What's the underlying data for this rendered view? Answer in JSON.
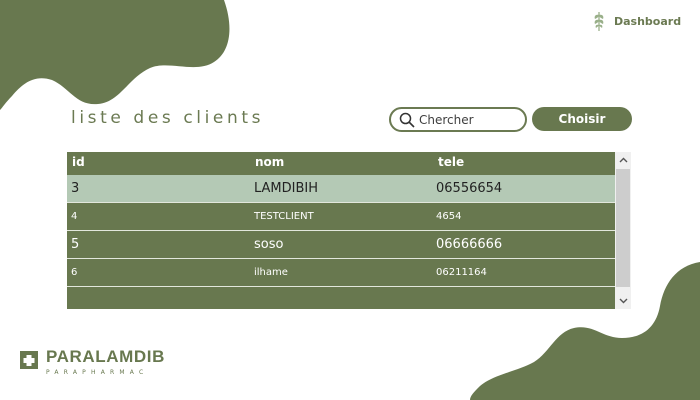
{
  "colors": {
    "primary": "#68784f",
    "selected_row": "#b4c9b5"
  },
  "nav": {
    "dashboard_label": "Dashboard",
    "dashboard_icon": "leaf-icon"
  },
  "page": {
    "title": "liste des clients"
  },
  "search": {
    "placeholder": "Chercher",
    "value": "",
    "icon": "search-icon"
  },
  "actions": {
    "choose_label": "Choisir"
  },
  "table": {
    "headers": {
      "id": "id",
      "nom": "nom",
      "tele": "tele"
    },
    "rows": [
      {
        "id": "3",
        "nom": "LAMDIBIH",
        "tele": "06556654",
        "selected": true
      },
      {
        "id": "4",
        "nom": "TESTCLIENT",
        "tele": "4654",
        "selected": false
      },
      {
        "id": "5",
        "nom": "soso",
        "tele": "06666666",
        "selected": false
      },
      {
        "id": "6",
        "nom": "ilhame",
        "tele": "06211164",
        "selected": false
      }
    ]
  },
  "logo": {
    "name": "PARALAMDIB",
    "subtitle": "PARAPHARMAC",
    "icon": "medical-cross-icon"
  }
}
